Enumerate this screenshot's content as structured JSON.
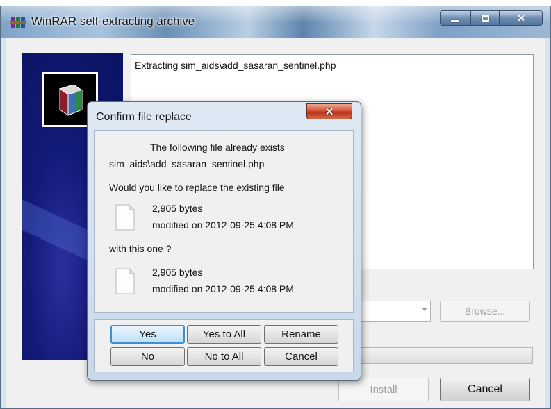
{
  "window": {
    "title": "WinRAR self-extracting archive",
    "icon": "winrar-icon"
  },
  "log": {
    "text": "Extracting sim_aids\\add_sasaran_sentinel.php"
  },
  "buttons": {
    "browse": "Browse...",
    "install": "Install",
    "cancel": "Cancel"
  },
  "dialog": {
    "title": "Confirm file replace",
    "close_glyph": "✕",
    "exists_text": "The following file already exists",
    "filename": "sim_aids\\add_sasaran_sentinel.php",
    "question": "Would you like to replace the existing file",
    "existing_file": {
      "size": "2,905 bytes",
      "modified": "modified on 2012-09-25 4:08 PM"
    },
    "with_this": "with this one ?",
    "new_file": {
      "size": "2,905 bytes",
      "modified": "modified on 2012-09-25 4:08 PM"
    },
    "buttons": {
      "yes": "Yes",
      "yes_to_all": "Yes to All",
      "rename": "Rename",
      "no": "No",
      "no_to_all": "No to All",
      "cancel": "Cancel"
    }
  },
  "colors": {
    "banner": "#121a78",
    "default_button_border": "#3c8fd0",
    "close_button": "#d5573b"
  }
}
